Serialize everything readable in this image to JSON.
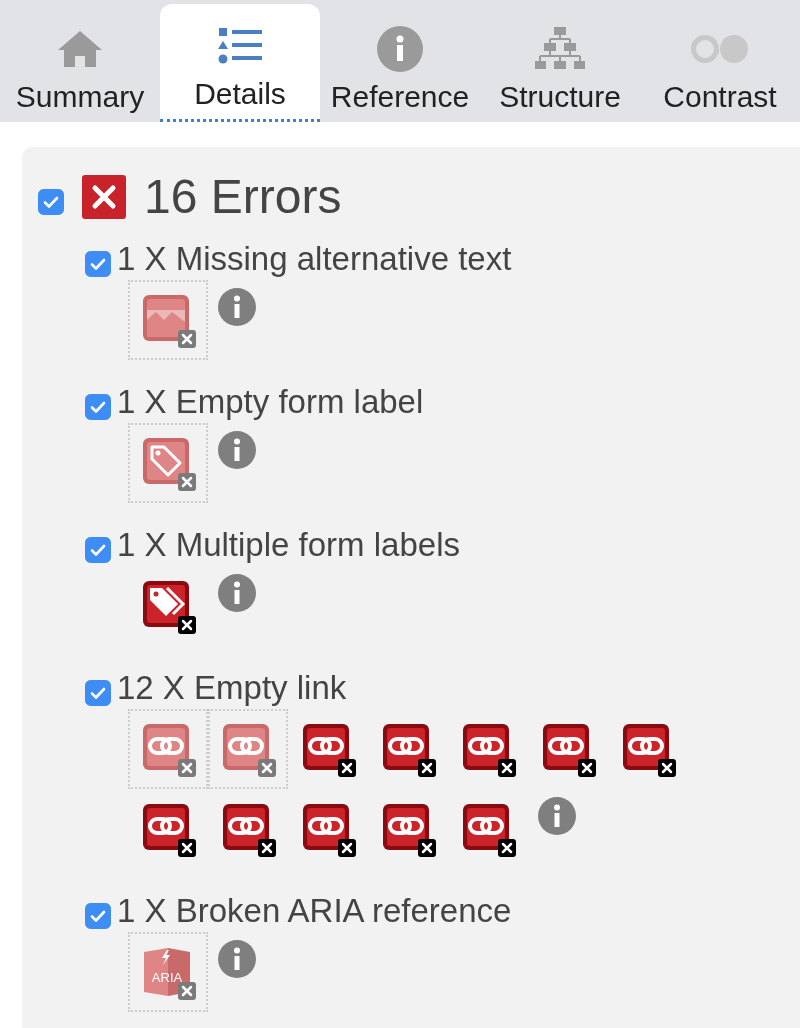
{
  "tabs": [
    {
      "label": "Summary",
      "kind": "home",
      "selected": false
    },
    {
      "label": "Details",
      "kind": "list",
      "selected": true
    },
    {
      "label": "Reference",
      "kind": "info",
      "selected": false
    },
    {
      "label": "Structure",
      "kind": "tree",
      "selected": false
    },
    {
      "label": "Contrast",
      "kind": "contrast",
      "selected": false
    }
  ],
  "errors": {
    "checked": true,
    "title": "16 Errors",
    "items": [
      {
        "checked": true,
        "title": "1 X Missing alternative text",
        "icons": [
          {
            "kind": "image",
            "hidden": true
          }
        ]
      },
      {
        "checked": true,
        "title": "1 X Empty form label",
        "icons": [
          {
            "kind": "tag",
            "hidden": true
          }
        ]
      },
      {
        "checked": true,
        "title": "1 X Multiple form labels",
        "icons": [
          {
            "kind": "tags",
            "hidden": false
          }
        ]
      },
      {
        "checked": true,
        "title": "12 X Empty link",
        "icons": [
          {
            "kind": "link",
            "hidden": true
          },
          {
            "kind": "link",
            "hidden": true
          },
          {
            "kind": "link",
            "hidden": false
          },
          {
            "kind": "link",
            "hidden": false
          },
          {
            "kind": "link",
            "hidden": false
          },
          {
            "kind": "link",
            "hidden": false
          },
          {
            "kind": "link",
            "hidden": false
          },
          {
            "kind": "link",
            "hidden": false
          },
          {
            "kind": "link",
            "hidden": false
          },
          {
            "kind": "link",
            "hidden": false
          },
          {
            "kind": "link",
            "hidden": false
          },
          {
            "kind": "link",
            "hidden": false
          }
        ]
      },
      {
        "checked": true,
        "title": "1 X Broken ARIA reference",
        "icons": [
          {
            "kind": "aria",
            "hidden": true,
            "label": "ARIA"
          }
        ]
      }
    ]
  }
}
